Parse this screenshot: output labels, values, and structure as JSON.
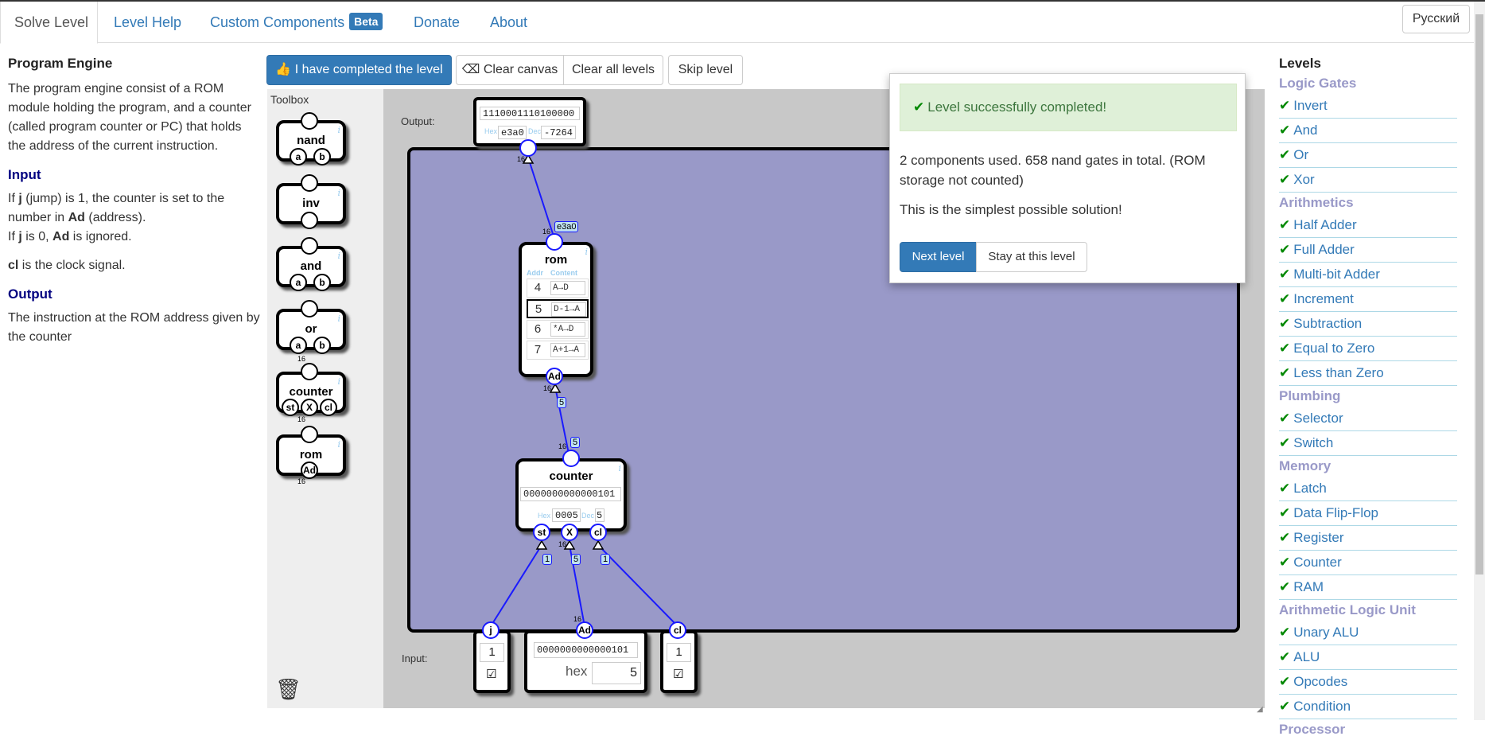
{
  "nav": {
    "tabs": [
      "Solve Level",
      "Level Help",
      "Custom Components",
      "Donate",
      "About"
    ],
    "beta": "Beta",
    "lang": "Русский"
  },
  "desc": {
    "title": "Program Engine",
    "intro": "The program engine consist of a ROM module holding the program, and a counter (called program counter or PC) that holds the address of the current instruction.",
    "input_h": "Input",
    "input_1_pre": "If ",
    "input_1_j": "j",
    "input_1_mid": " (jump) is 1, the counter is set to the number in ",
    "input_1_ad": "Ad",
    "input_1_post": " (address).",
    "input_2_pre": "If ",
    "input_2_j": "j",
    "input_2_mid": " is 0, ",
    "input_2_ad": "Ad",
    "input_2_post": " is ignored.",
    "input_3_cl": "cl",
    "input_3_post": " is the clock signal.",
    "output_h": "Output",
    "output_text": "The instruction at the ROM address given by the counter"
  },
  "toolbar": {
    "completed": "I have completed the level",
    "clear_canvas": "Clear canvas",
    "clear_all": "Clear all levels",
    "skip": "Skip level"
  },
  "toolbox": {
    "title": "Toolbox",
    "items": [
      "nand",
      "inv",
      "and",
      "or",
      "counter",
      "rom"
    ],
    "pins": {
      "a": "a",
      "b": "b",
      "st": "st",
      "x": "X",
      "cl": "cl",
      "ad": "Ad"
    },
    "width": "16"
  },
  "canvas": {
    "output_label": "Output:",
    "input_label": "Input:",
    "output": {
      "bits": "1110001110100000",
      "hex_label": "Hex",
      "hex": "e3a0",
      "dec_label": "Dec",
      "dec": "-7264",
      "width": "16"
    },
    "rom": {
      "name": "rom",
      "addr_h": "Addr",
      "content_h": "Content",
      "rows": [
        {
          "a": "4",
          "c": "A→D"
        },
        {
          "a": "5",
          "c": "D-1→A"
        },
        {
          "a": "6",
          "c": "*A→D"
        },
        {
          "a": "7",
          "c": "A+1→A"
        }
      ],
      "pin": "Ad",
      "tag_in": "e3a0",
      "tag_out": "5",
      "width": "16"
    },
    "counter": {
      "name": "counter",
      "bits": "0000000000000101",
      "hex_label": "Hex",
      "hex": "0005",
      "dec_label": "Dec",
      "dec": "5",
      "pins": [
        "st",
        "X",
        "cl"
      ],
      "tag_top": "5",
      "tags": [
        "1",
        "5",
        "1"
      ],
      "width": "16"
    },
    "inputs": {
      "j": {
        "pin": "j",
        "value": "1"
      },
      "ad": {
        "pin": "Ad",
        "bits": "0000000000000101",
        "hex_label": "hex",
        "value": "5"
      },
      "cl": {
        "pin": "cl",
        "value": "1"
      },
      "check": "☑"
    }
  },
  "popup": {
    "success": "Level successfully completed!",
    "stats": "2 components used. 658 nand gates in total. (ROM storage not counted)",
    "simplest": "This is the simplest possible solution!",
    "next": "Next level",
    "stay": "Stay at this level"
  },
  "levels": {
    "title": "Levels",
    "groups": [
      {
        "name": "Logic Gates",
        "items": [
          "Invert",
          "And",
          "Or",
          "Xor"
        ]
      },
      {
        "name": "Arithmetics",
        "items": [
          "Half Adder",
          "Full Adder",
          "Multi-bit Adder",
          "Increment",
          "Subtraction",
          "Equal to Zero",
          "Less than Zero"
        ]
      },
      {
        "name": "Plumbing",
        "items": [
          "Selector",
          "Switch"
        ]
      },
      {
        "name": "Memory",
        "items": [
          "Latch",
          "Data Flip-Flop",
          "Register",
          "Counter",
          "RAM"
        ]
      },
      {
        "name": "Arithmetic Logic Unit",
        "items": [
          "Unary ALU",
          "ALU",
          "Opcodes",
          "Condition"
        ]
      },
      {
        "name": "Processor",
        "items": []
      }
    ]
  },
  "colors": {
    "primary": "#337ab7",
    "board": "#9999c8",
    "wire": "#1a1aff",
    "check": "#008800",
    "category": "#9999c8"
  }
}
